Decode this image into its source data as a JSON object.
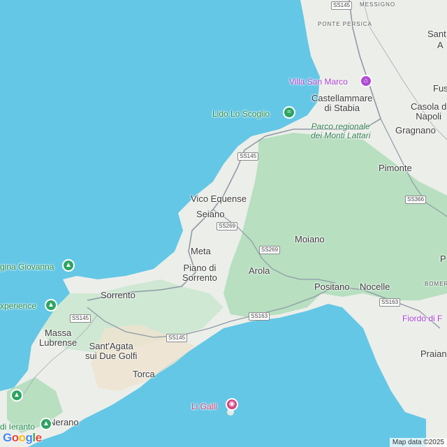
{
  "labels": {
    "messigno": "MESSIGNO",
    "ponte_persica": "PONTE PERSICA",
    "sant": "Sant",
    "a": "A",
    "fus": "Fus",
    "castellammare": "Castellammare\ndi Stabia",
    "casola": "Casola d\nNapoli",
    "parco": "Parco regionale\ndei Monti Lattari",
    "gragnano": "Gragnano",
    "pimonte": "Pimonte",
    "vico_equense": "Vico Equense",
    "seiano": "Seiano",
    "moiano": "Moiano",
    "meta": "Meta",
    "piano_di_sorrento": "Piano di\nSorrento",
    "arola": "Arola",
    "positano": "Positano",
    "nocelle": "Nocelle",
    "bomer": "BOMER",
    "sorrento": "Sorrento",
    "massa_lubrense": "Massa\nLubrense",
    "santagata": "Sant'Agata\nsui Due Golfi",
    "torca": "Torca",
    "nerano": "Nerano",
    "praian": "Praian",
    "p_right": "P"
  },
  "pois": {
    "villa_san_marco": "Villa San Marco",
    "lido_lo_scoglio": "Lido Lo Scoglio",
    "regina_giovanna": "gina Giovanna",
    "experience": "xperience",
    "li_galli": "Li Galli",
    "fiordo": "Fiordo di F",
    "ieranto": "di Ieranto"
  },
  "roads": {
    "ss145_top": "SS145",
    "ss145_a": "SS145",
    "ss269_a": "SS269",
    "ss269_b": "SS269",
    "ss366": "SS366",
    "ss163_a": "SS163",
    "ss163_b": "SS163",
    "ss145_b": "SS145",
    "ss145_c": "SS145"
  },
  "attribution": "Map data ©2025",
  "google_logo": [
    "G",
    "o",
    "o",
    "g",
    "l",
    "e"
  ],
  "colors": {
    "sea": "#64c7e6",
    "land": "#e9eee8",
    "green": "#b9e0c3",
    "road": "#8f9aa6"
  },
  "icons": {
    "museum": "museum-icon",
    "beach": "beach-icon",
    "park": "park-icon",
    "camera": "camera-icon"
  }
}
